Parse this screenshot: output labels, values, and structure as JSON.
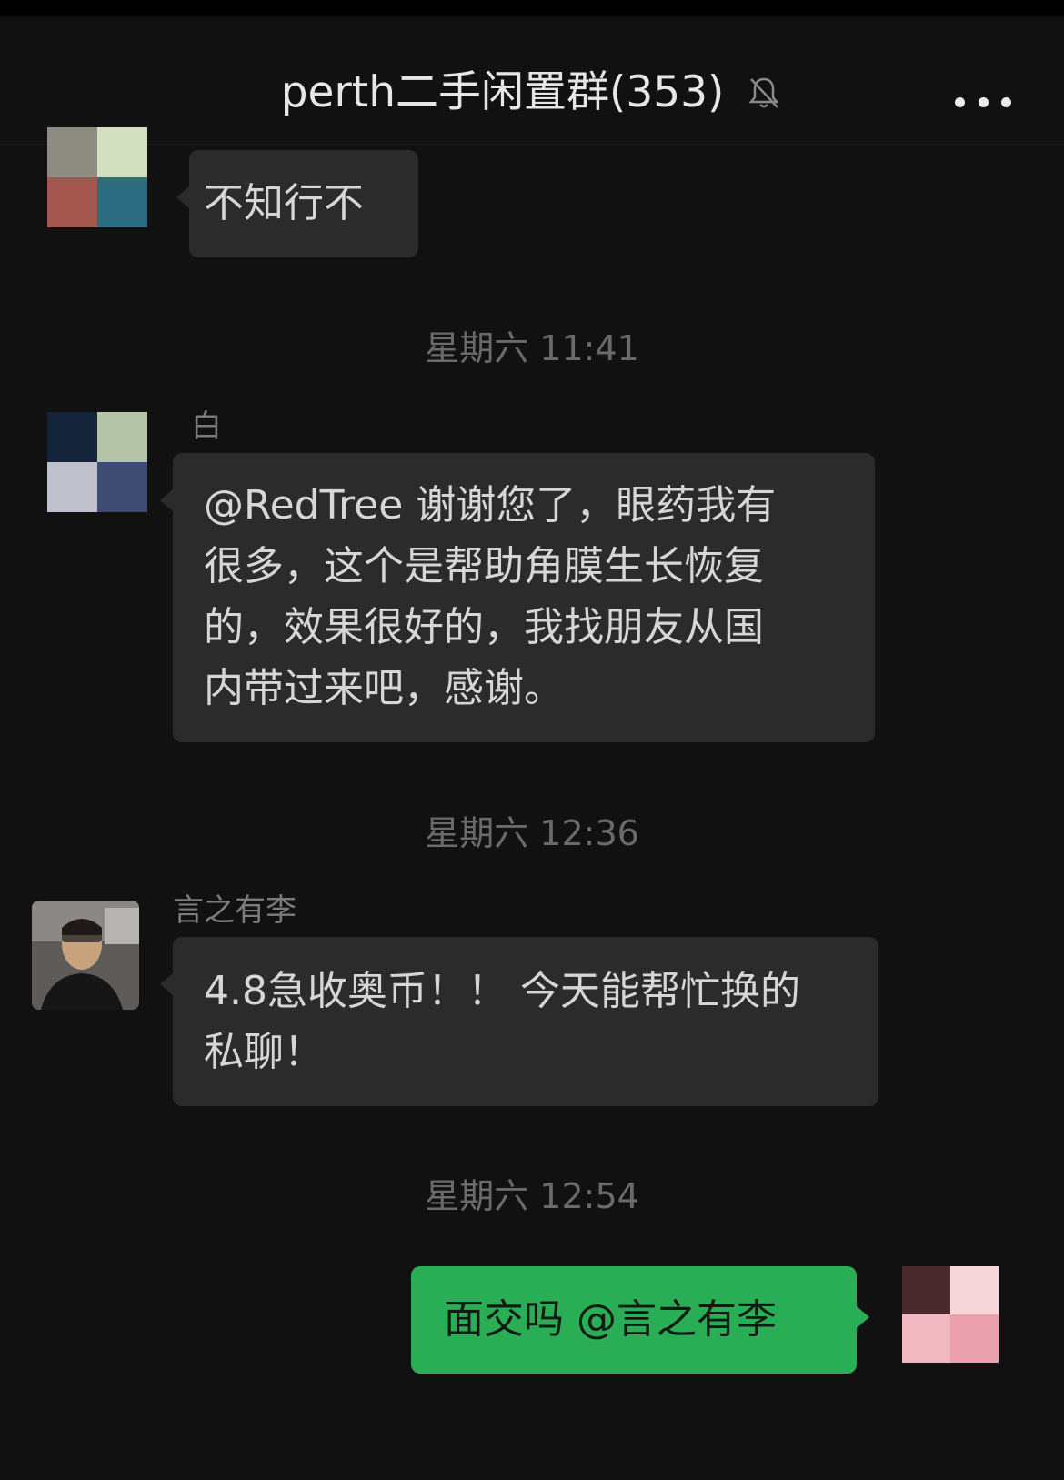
{
  "header": {
    "title": "perth二手闲置群(353)",
    "mute_icon": "bell-slash-icon",
    "more_icon": "more-dots-icon"
  },
  "colors": {
    "background": "#111111",
    "incoming_bubble": "#2b2b2b",
    "outgoing_bubble": "#2aae55",
    "timestamp_text": "#6a6a6a"
  },
  "messages": [
    {
      "type": "incoming",
      "text": "不知行不",
      "avatar_colors": [
        "#8f8c83",
        "#d5dfc1",
        "#a3574f",
        "#2d6c80"
      ]
    },
    {
      "type": "timestamp",
      "text": "星期六 11:41"
    },
    {
      "type": "incoming",
      "sender": "白",
      "text": "@RedTree 谢谢您了，眼药我有很多，这个是帮助角膜生长恢复的，效果很好的，我找朋友从国内带过来吧，感谢。",
      "lines": [
        "@RedTree 谢谢您了，眼药我有",
        "很多，这个是帮助角膜生长恢复",
        "的，效果很好的，我找朋友从国",
        "内带过来吧，感谢。"
      ],
      "avatar_colors": [
        "#14243b",
        "#b5c4a6",
        "#bfc0cc",
        "#3e4b72"
      ]
    },
    {
      "type": "timestamp",
      "text": "星期六 12:36"
    },
    {
      "type": "incoming",
      "sender": "言之有李",
      "text": "4.8急收奥币！！今天能帮忙换的私聊！",
      "lines": [
        "4.8急收奥币！！ 今天能帮忙换的",
        "私聊！"
      ],
      "avatar_desc": "photo-avatar"
    },
    {
      "type": "timestamp",
      "text": "星期六 12:54"
    },
    {
      "type": "outgoing",
      "text": "面交吗 @言之有李",
      "avatar_colors": [
        "#4b2a2d",
        "#f6d6da",
        "#f1bac3",
        "#eaa1ad"
      ]
    }
  ]
}
